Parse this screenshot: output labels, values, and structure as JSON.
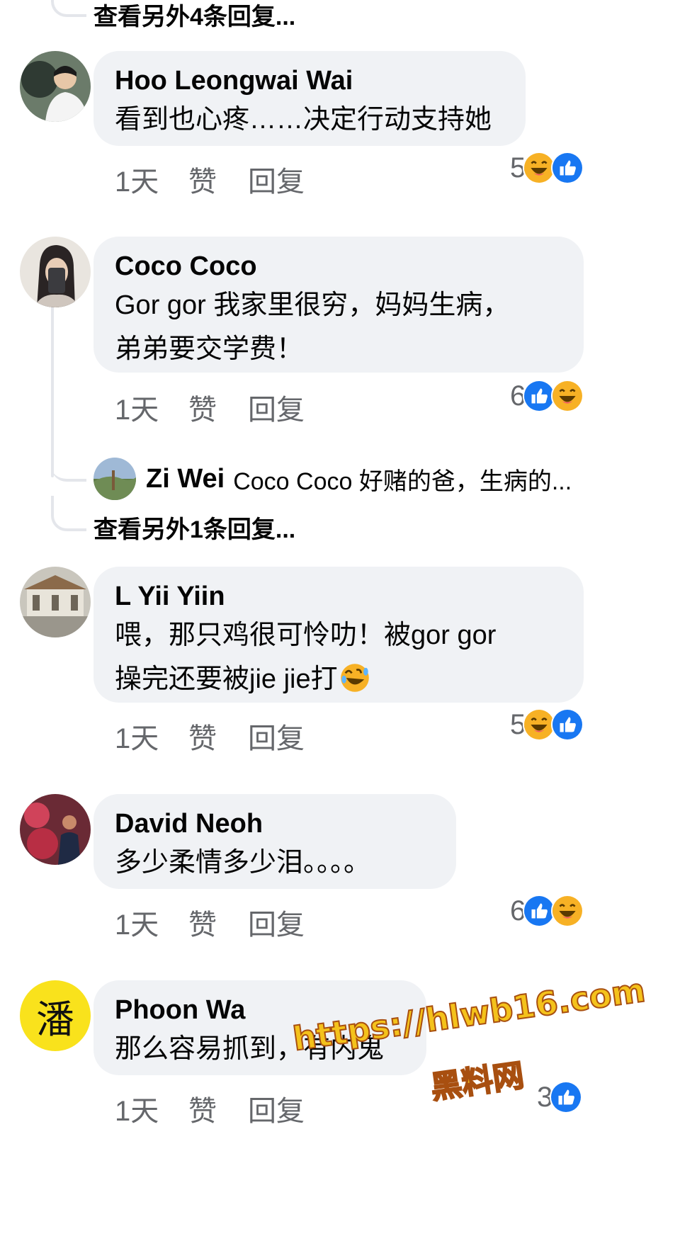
{
  "thread_top": {
    "view_more": "查看另外4条回复..."
  },
  "comments": [
    {
      "name": "Hoo Leongwai Wai",
      "text": "看到也心疼……决定行动支持她",
      "time": "1天",
      "like": "赞",
      "reply": "回复",
      "count": "5",
      "reactions": [
        "haha-icon",
        "like-icon"
      ]
    },
    {
      "name": "Coco Coco",
      "text": "Gor gor 我家里很穷，妈妈生病，\n弟弟要交学费！",
      "time": "1天",
      "like": "赞",
      "reply": "回复",
      "count": "6",
      "reactions": [
        "like-icon",
        "haha-icon"
      ]
    },
    {
      "name": "L Yii Yiin",
      "text": "喂，那只鸡很可怜叻！被gor gor\n操完还要被jie jie打",
      "time": "1天",
      "like": "赞",
      "reply": "回复",
      "count": "5",
      "reactions": [
        "haha-icon",
        "like-icon"
      ]
    },
    {
      "name": "David Neoh",
      "text": "多少柔情多少泪。。。。",
      "time": "1天",
      "like": "赞",
      "reply": "回复",
      "count": "6",
      "reactions": [
        "like-icon",
        "haha-icon"
      ]
    },
    {
      "name": "Phoon Wa",
      "text": "那么容易抓到，有内鬼",
      "time": "1天",
      "like": "赞",
      "reply": "回复",
      "count": "3",
      "reactions": [
        "like-icon"
      ]
    }
  ],
  "nested_reply": {
    "name": "Zi Wei",
    "text": "Coco Coco 好赌的爸，生病的..."
  },
  "thread_mid": {
    "view_more": "查看另外1条回复..."
  },
  "avatar_phoon_char": "潘",
  "watermark": {
    "url": "https://hlwb16.com",
    "site": "黑料网"
  },
  "colors": {
    "bubble": "#f0f2f5",
    "meta": "#65676b",
    "like_blue": "#1877f2",
    "haha_yellow": "#f7b125"
  }
}
